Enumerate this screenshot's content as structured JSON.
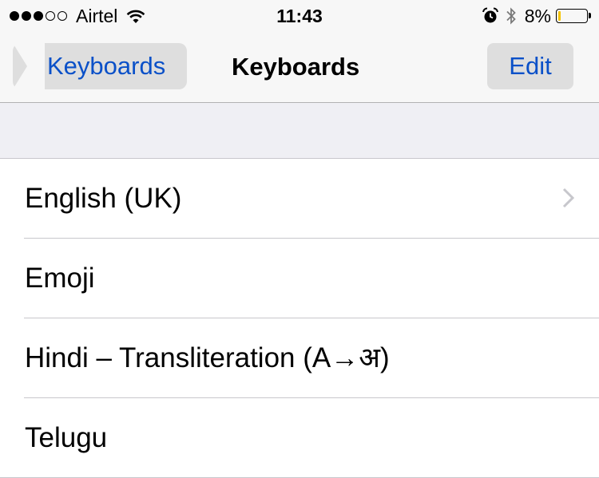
{
  "status_bar": {
    "signal_dots": [
      true,
      true,
      true,
      false,
      false
    ],
    "carrier": "Airtel",
    "time": "11:43",
    "battery_percent_text": "8%",
    "battery_level": 0.08,
    "icons": [
      "wifi-icon",
      "alarm-icon",
      "bluetooth-icon",
      "battery-icon"
    ]
  },
  "nav": {
    "back_label": "Keyboards",
    "title": "Keyboards",
    "edit_label": "Edit"
  },
  "colors": {
    "accent": "#0a50c8",
    "battery_low": "#f5c400",
    "grouped_background": "#efeff4"
  },
  "keyboards": [
    {
      "label": "English (UK)",
      "has_chevron": true
    },
    {
      "label": "Emoji",
      "has_chevron": false
    },
    {
      "label": "Hindi – Transliteration (A→अ)",
      "has_chevron": false
    },
    {
      "label": "Telugu",
      "has_chevron": false
    }
  ]
}
